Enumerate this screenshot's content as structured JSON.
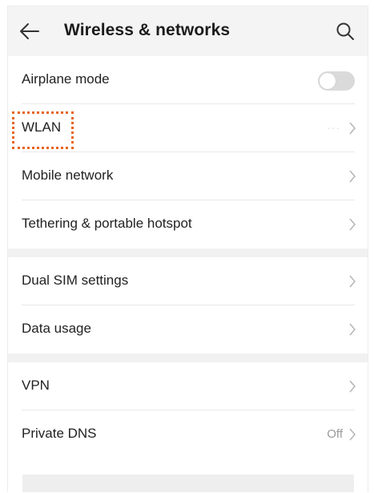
{
  "header": {
    "back_icon": "arrow-left-icon",
    "title": "Wireless & networks",
    "search_icon": "search-icon"
  },
  "rows": {
    "airplane": {
      "label": "Airplane mode",
      "toggle_on": false
    },
    "wlan": {
      "label": "WLAN",
      "status_faded": "···"
    },
    "mobile": {
      "label": "Mobile network"
    },
    "tethering": {
      "label": "Tethering & portable hotspot"
    },
    "dual_sim": {
      "label": "Dual SIM settings"
    },
    "data_usage": {
      "label": "Data usage"
    },
    "vpn": {
      "label": "VPN"
    },
    "private_dns": {
      "label": "Private DNS",
      "status": "Off"
    }
  },
  "colors": {
    "highlight": "#e8641c",
    "gap": "#f1f1f1",
    "toggle_off": "#dadada"
  }
}
